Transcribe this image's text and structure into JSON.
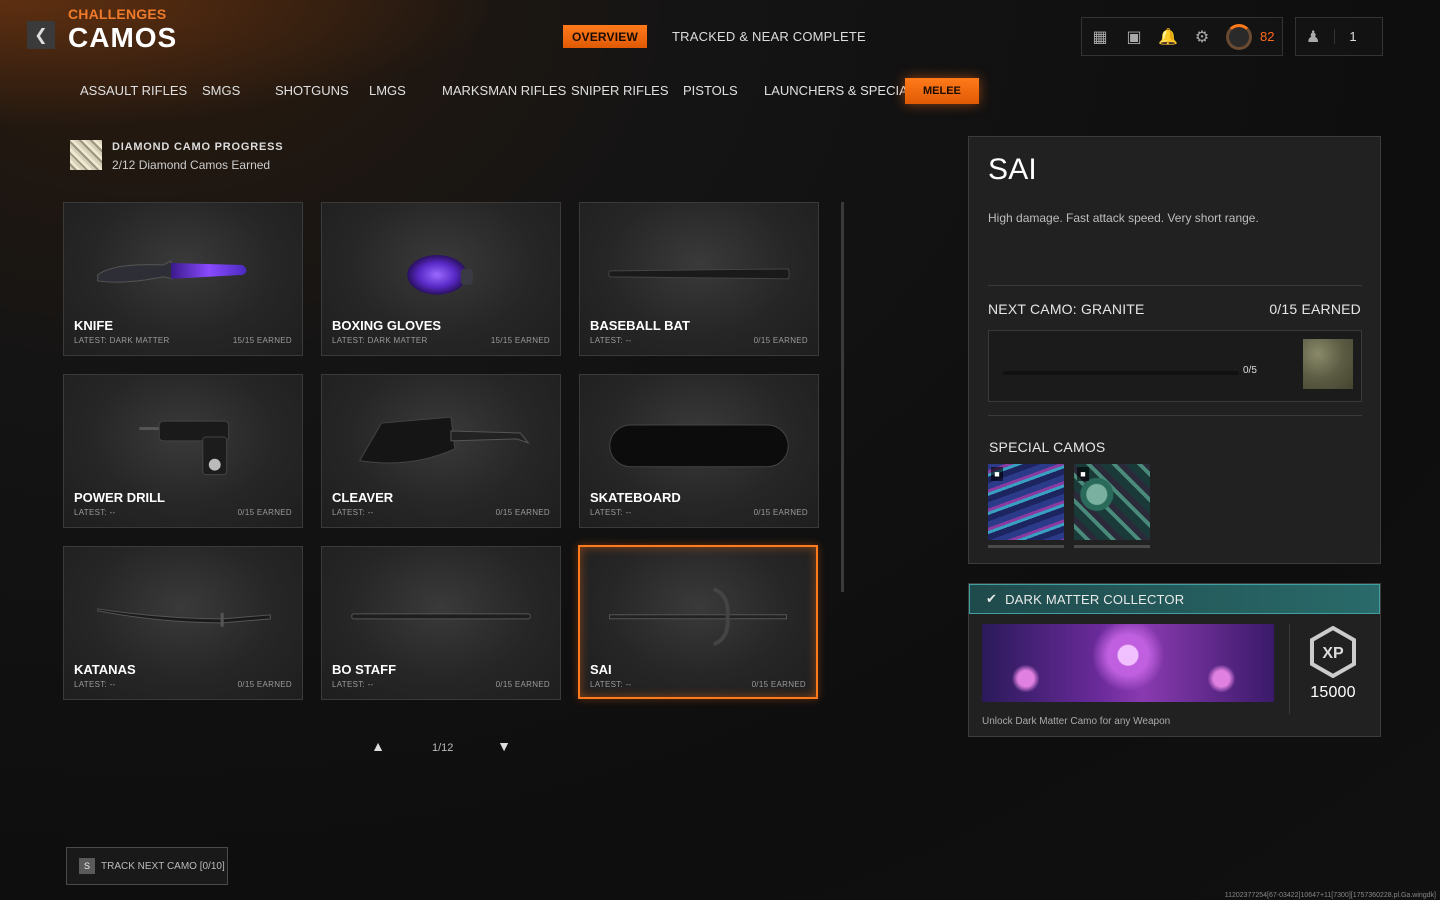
{
  "header": {
    "section": "CHALLENGES",
    "title": "CAMOS",
    "tabs": [
      {
        "label": "OVERVIEW",
        "active": true
      },
      {
        "label": "TRACKED & NEAR COMPLETE",
        "active": false
      }
    ],
    "player_level": "82",
    "party_count": "1"
  },
  "categories": [
    {
      "label": "ASSAULT RIFLES",
      "active": false
    },
    {
      "label": "SMGS",
      "active": false
    },
    {
      "label": "SHOTGUNS",
      "active": false
    },
    {
      "label": "LMGS",
      "active": false
    },
    {
      "label": "MARKSMAN RIFLES",
      "active": false
    },
    {
      "label": "SNIPER RIFLES",
      "active": false
    },
    {
      "label": "PISTOLS",
      "active": false
    },
    {
      "label": "LAUNCHERS & SPECIALS",
      "active": false
    },
    {
      "label": "MELEE",
      "active": true
    }
  ],
  "diamond_progress": {
    "title": "DIAMOND CAMO PROGRESS",
    "subtitle": "2/12 Diamond Camos Earned"
  },
  "weapons": [
    {
      "name": "KNIFE",
      "latest": "LATEST: DARK MATTER",
      "earned": "15/15 EARNED",
      "icon": "knife-icon"
    },
    {
      "name": "BOXING GLOVES",
      "latest": "LATEST: DARK MATTER",
      "earned": "15/15 EARNED",
      "icon": "boxing-gloves-icon"
    },
    {
      "name": "BASEBALL BAT",
      "latest": "LATEST: --",
      "earned": "0/15 EARNED",
      "icon": "baseball-bat-icon"
    },
    {
      "name": "POWER DRILL",
      "latest": "LATEST: --",
      "earned": "0/15 EARNED",
      "icon": "power-drill-icon"
    },
    {
      "name": "CLEAVER",
      "latest": "LATEST: --",
      "earned": "0/15 EARNED",
      "icon": "cleaver-icon"
    },
    {
      "name": "SKATEBOARD",
      "latest": "LATEST: --",
      "earned": "0/15 EARNED",
      "icon": "skateboard-icon"
    },
    {
      "name": "KATANAS",
      "latest": "LATEST: --",
      "earned": "0/15 EARNED",
      "icon": "katana-icon"
    },
    {
      "name": "BO STAFF",
      "latest": "LATEST: --",
      "earned": "0/15 EARNED",
      "icon": "bo-staff-icon"
    },
    {
      "name": "SAI",
      "latest": "LATEST: --",
      "earned": "0/15 EARNED",
      "icon": "sai-icon",
      "selected": true
    }
  ],
  "pager": {
    "text": "1/12"
  },
  "track_button": {
    "key": "S",
    "label": "TRACK NEXT CAMO [0/10]"
  },
  "details": {
    "title": "SAI",
    "description": "High damage.  Fast attack speed. Very short range.",
    "next_camo_label": "NEXT CAMO: GRANITE",
    "next_camo_earned": "0/15 EARNED",
    "progress_text": "0/5",
    "progress_fraction": 0,
    "special_label": "SPECIAL CAMOS"
  },
  "reward": {
    "title": "DARK MATTER COLLECTOR",
    "xp": "15000",
    "xp_badge": "XP",
    "description": "Unlock Dark Matter Camo for any Weapon"
  },
  "footer_id": "11202377254[67-03422]10647+11[7300][1757360228.pl.Ga.wingdk]"
}
